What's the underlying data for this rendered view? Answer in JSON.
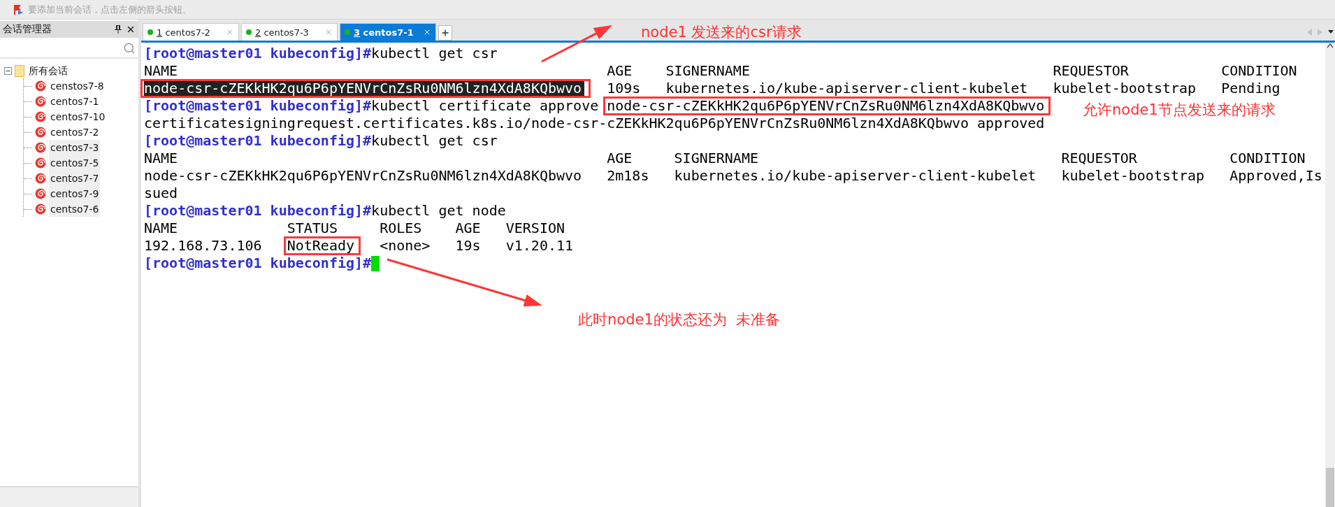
{
  "top_bar": {
    "hint": "要添加当前会话，点击左侧的箭头按钮。"
  },
  "sidebar": {
    "title": "会话管理器",
    "tree": {
      "label": "所有会话",
      "expanded": true,
      "children": [
        {
          "label": "censtos7-8",
          "selected": false
        },
        {
          "label": "centos7-1",
          "selected": false
        },
        {
          "label": "centos7-10",
          "selected": false
        },
        {
          "label": "centos7-2",
          "selected": false
        },
        {
          "label": "centos7-3",
          "selected": true
        },
        {
          "label": "centos7-5",
          "selected": true
        },
        {
          "label": "centos7-7",
          "selected": true
        },
        {
          "label": "centos7-9",
          "selected": true
        },
        {
          "label": "centso7-6",
          "selected": true
        }
      ]
    }
  },
  "tabs": [
    {
      "number": "1",
      "label": "centos7-2",
      "selected": false
    },
    {
      "number": "2",
      "label": "centos7-3",
      "selected": false
    },
    {
      "number": "3",
      "label": "centos7-1",
      "selected": true
    }
  ],
  "terminal": {
    "lines": [
      {
        "kind": "command",
        "prompt": "[root@master01 kubeconfig]#",
        "command": "kubectl get csr",
        "cursor": false
      },
      {
        "kind": "table",
        "cells": [
          {
            "text": "NAME",
            "selected": false,
            "boxed": false
          },
          {
            "text": "AGE",
            "selected": false,
            "boxed": false
          },
          {
            "text": "SIGNERNAME",
            "selected": false,
            "boxed": false
          },
          {
            "text": "REQUESTOR",
            "selected": false,
            "boxed": false
          },
          {
            "text": "CONDITION",
            "selected": false,
            "boxed": false
          }
        ]
      },
      {
        "kind": "table",
        "cells": [
          {
            "text": "node-csr-cZEKkHK2qu6P6pYENVrCnZsRu0NM6lzn4XdA8KQbwvo",
            "selected": true,
            "boxed": true
          },
          {
            "text": "109s",
            "selected": false,
            "boxed": false
          },
          {
            "text": "kubernetes.io/kube-apiserver-client-kubelet",
            "selected": false,
            "boxed": false
          },
          {
            "text": "kubelet-bootstrap",
            "selected": false,
            "boxed": false
          },
          {
            "text": "Pending",
            "selected": false,
            "boxed": false
          }
        ]
      },
      {
        "kind": "command",
        "prompt": "[root@master01 kubeconfig]#",
        "command": "kubectl certificate approve",
        "argument": "node-csr-cZEKkHK2qu6P6pYENVrCnZsRu0NM6lzn4XdA8KQbwvo",
        "boxed": true,
        "cursor": false
      },
      {
        "kind": "text",
        "text": "certificatesigningrequest.certificates.k8s.io/node-csr-cZEKkHK2qu6P6pYENVrCnZsRu0NM6lzn4XdA8KQbwvo approved"
      },
      {
        "kind": "command",
        "prompt": "[root@master01 kubeconfig]#",
        "command": "kubectl get csr",
        "cursor": false
      },
      {
        "kind": "table",
        "cells": [
          {
            "text": "NAME",
            "selected": false,
            "boxed": false
          },
          {
            "text": "AGE",
            "selected": false,
            "boxed": false
          },
          {
            "text": "SIGNERNAME",
            "selected": false,
            "boxed": false
          },
          {
            "text": "REQUESTOR",
            "selected": false,
            "boxed": false
          },
          {
            "text": "CONDITION",
            "selected": false,
            "boxed": false
          }
        ]
      },
      {
        "kind": "table",
        "cells": [
          {
            "text": "node-csr-cZEKkHK2qu6P6pYENVrCnZsRu0NM6lzn4XdA8KQbwvo",
            "selected": false,
            "boxed": false
          },
          {
            "text": "2m18s",
            "selected": false,
            "boxed": false
          },
          {
            "text": "kubernetes.io/kube-apiserver-client-kubelet",
            "selected": false,
            "boxed": false
          },
          {
            "text": "kubelet-bootstrap",
            "selected": false,
            "boxed": false
          },
          {
            "text": "Approved,Is",
            "selected": false,
            "boxed": false
          }
        ]
      },
      {
        "kind": "text",
        "text": "sued"
      },
      {
        "kind": "command",
        "prompt": "[root@master01 kubeconfig]#",
        "command": "kubectl get node",
        "cursor": false
      },
      {
        "kind": "table",
        "cells": [
          {
            "text": "NAME",
            "selected": false,
            "boxed": false
          },
          {
            "text": "STATUS",
            "selected": false,
            "boxed": false
          },
          {
            "text": "ROLES",
            "selected": false,
            "boxed": false
          },
          {
            "text": "AGE",
            "selected": false,
            "boxed": false
          },
          {
            "text": "VERSION",
            "selected": false,
            "boxed": false
          }
        ]
      },
      {
        "kind": "table",
        "cells": [
          {
            "text": "192.168.73.106",
            "selected": false,
            "boxed": false
          },
          {
            "text": "NotReady",
            "selected": false,
            "boxed": true
          },
          {
            "text": "<none>",
            "selected": false,
            "boxed": false
          },
          {
            "text": "19s",
            "selected": false,
            "boxed": false
          },
          {
            "text": "v1.20.11",
            "selected": false,
            "boxed": false
          }
        ]
      },
      {
        "kind": "command",
        "prompt": "[root@master01 kubeconfig]#",
        "cursor": true
      }
    ]
  },
  "annotations": [
    {
      "text": "node1 发送来的csr请求"
    },
    {
      "text": "允许node1节点发送来的请求"
    },
    {
      "text": "此时node1的状态还为  未准备"
    }
  ]
}
